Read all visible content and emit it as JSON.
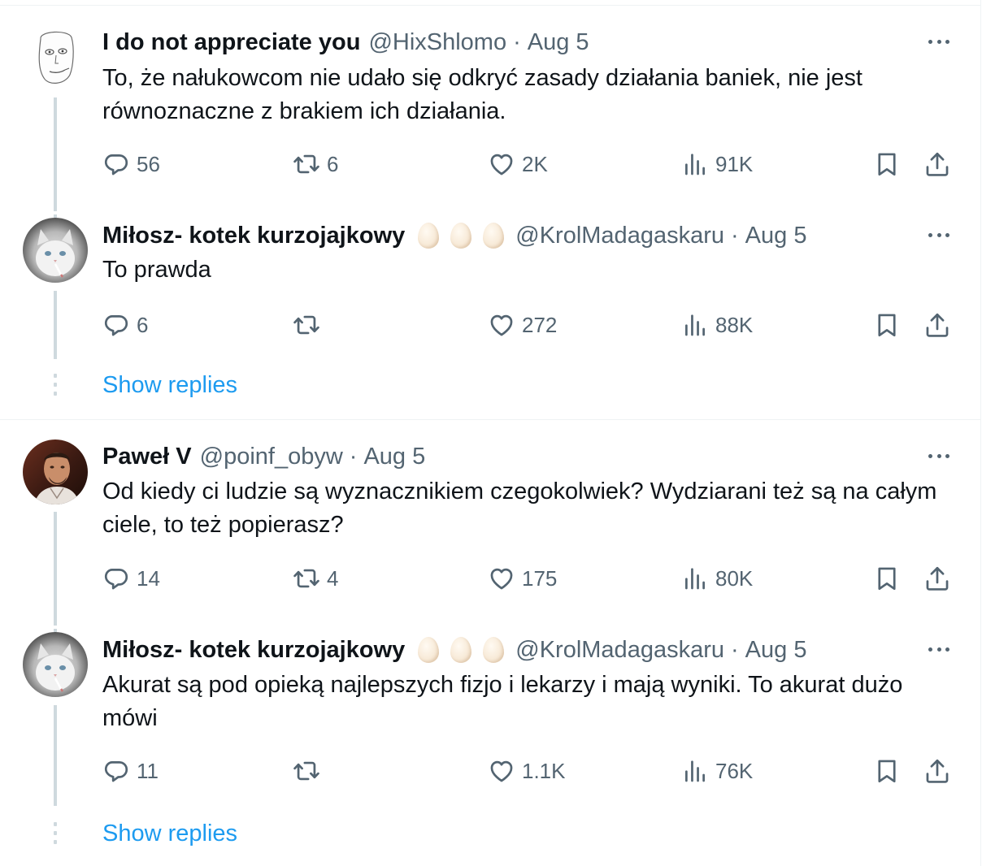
{
  "tweets": [
    {
      "name": "I do not appreciate you",
      "handle": "@HixShlomo",
      "sep": "·",
      "date": "Aug 5",
      "text": "To, że nałukowcom nie udało się odkryć zasady działania baniek, nie jest równoznaczne z brakiem ich działania.",
      "replies": "56",
      "retweets": "6",
      "likes": "2K",
      "views": "91K"
    },
    {
      "name": "Miłosz- kotek kurzojajkowy",
      "emoji": [
        "egg",
        "egg",
        "egg"
      ],
      "handle": "@KrolMadagaskaru",
      "sep": "·",
      "date": "Aug 5",
      "text": "To prawda",
      "replies": "6",
      "retweets": "",
      "likes": "272",
      "views": "88K"
    },
    {
      "name": "Paweł V",
      "handle": "@poinf_obyw",
      "sep": "·",
      "date": "Aug 5",
      "text": "Od kiedy ci ludzie są wyznacznikiem czegokolwiek? Wydziarani też są na całym ciele, to też popierasz?",
      "replies": "14",
      "retweets": "4",
      "likes": "175",
      "views": "80K"
    },
    {
      "name": "Miłosz- kotek kurzojajkowy",
      "emoji": [
        "egg",
        "egg",
        "egg"
      ],
      "handle": "@KrolMadagaskaru",
      "sep": "·",
      "date": "Aug 5",
      "text": "Akurat są pod opieką najlepszych fizjo i lekarzy i mają wyniki. To akurat dużo mówi",
      "replies": "11",
      "retweets": "",
      "likes": "1.1K",
      "views": "76K"
    }
  ],
  "show_replies": [
    "Show replies",
    "Show replies"
  ],
  "icons": [
    "reply-icon",
    "retweet-icon",
    "like-icon",
    "views-icon",
    "bookmark-icon",
    "share-icon",
    "more-icon"
  ],
  "colors": {
    "text": "#0f1419",
    "secondary": "#536471",
    "link": "#1d9bf0",
    "thread_line": "#cfd9de",
    "divider": "#eff3f4"
  }
}
